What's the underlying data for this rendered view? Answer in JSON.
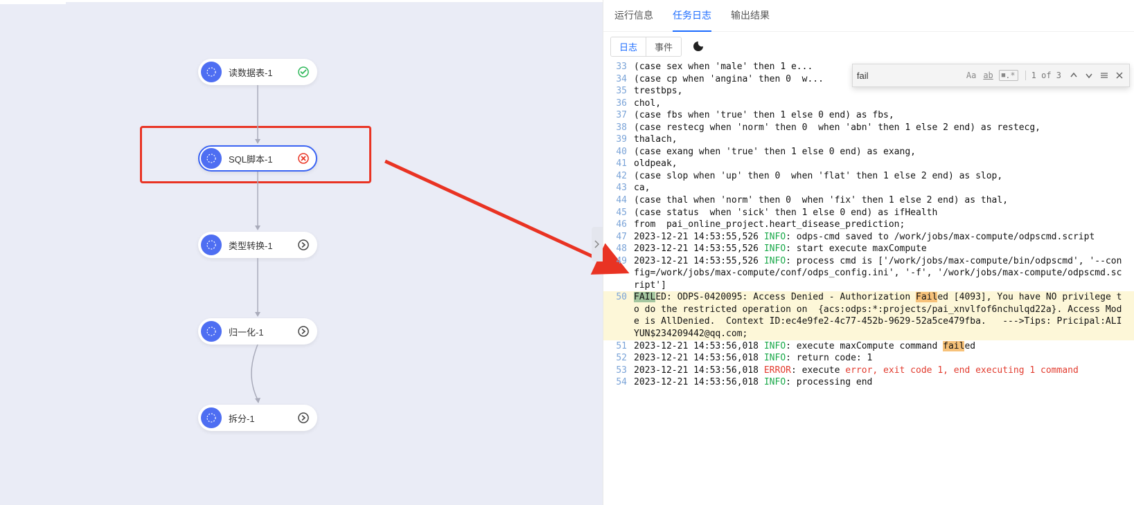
{
  "nodes": {
    "n1": {
      "label": "读数据表-1",
      "status": "success"
    },
    "n2": {
      "label": "SQL脚本-1",
      "status": "error",
      "selected": true
    },
    "n3": {
      "label": "类型转换-1",
      "status": "more"
    },
    "n4": {
      "label": "归一化-1",
      "status": "more"
    },
    "n5": {
      "label": "拆分-1",
      "status": "more"
    }
  },
  "tabs": {
    "runinfo": "运行信息",
    "tasklog": "任务日志",
    "output": "输出结果"
  },
  "subtabs": {
    "log": "日志",
    "event": "事件"
  },
  "search": {
    "value": "fail",
    "count": "1 of 3",
    "icons": {
      "case": "Aa",
      "word": "ab",
      "regex": ".*"
    }
  },
  "log": [
    {
      "n": "33",
      "t": "(case sex when 'male' then 1 e..."
    },
    {
      "n": "34",
      "t": "(case cp when 'angina' then 0  w..."
    },
    {
      "n": "35",
      "t": "trestbps,"
    },
    {
      "n": "36",
      "t": "chol,"
    },
    {
      "n": "37",
      "t": "(case fbs when 'true' then 1 else 0 end) as fbs,"
    },
    {
      "n": "38",
      "t": "(case restecg when 'norm' then 0  when 'abn' then 1 else 2 end) as restecg,"
    },
    {
      "n": "39",
      "t": "thalach,"
    },
    {
      "n": "40",
      "t": "(case exang when 'true' then 1 else 0 end) as exang,"
    },
    {
      "n": "41",
      "t": "oldpeak,"
    },
    {
      "n": "42",
      "t": "(case slop when 'up' then 0  when 'flat' then 1 else 2 end) as slop,"
    },
    {
      "n": "43",
      "t": "ca,"
    },
    {
      "n": "44",
      "t": "(case thal when 'norm' then 0  when 'fix' then 1 else 2 end) as thal,"
    },
    {
      "n": "45",
      "t": "(case status  when 'sick' then 1 else 0 end) as ifHealth"
    },
    {
      "n": "46",
      "t": "from  pai_online_project.heart_disease_prediction;"
    },
    {
      "n": "47",
      "t": "2023-12-21 14:53:55,526 <span class=\"kw-info\">INFO</span>: odps-cmd saved to /work/jobs/max-compute/odpscmd.script"
    },
    {
      "n": "48",
      "t": "2023-12-21 14:53:55,526 <span class=\"kw-info\">INFO</span>: start execute maxCompute"
    },
    {
      "n": "49",
      "t": "2023-12-21 14:53:55,526 <span class=\"kw-info\">INFO</span>: process cmd is ['/work/jobs/max-compute/bin/odpscmd', '--config=/work/jobs/max-compute/conf/odps_config.ini', '-f', '/work/jobs/max-compute/odpscmd.script']"
    },
    {
      "n": "50",
      "hl": true,
      "t": "<span class=\"kw-hlsel\">FAIL</span>ED: ODPS-0420095: Access Denied - Authorization <span class=\"kw-hl\">Fail</span>ed [4093], You have NO privilege to do the restricted operation on  {acs:odps:*:projects/pai_xnvlfof6nchulqd22a}. Access Mode is AllDenied.  Context ID:ec4e9fe2-4c77-452b-9629-52a5ce479fba.   --->Tips: Pricipal:ALIYUN$234209442@qq.com;"
    },
    {
      "n": "51",
      "t": "2023-12-21 14:53:56,018 <span class=\"kw-info\">INFO</span>: execute maxCompute command <span class=\"kw-hl\">fail</span>ed"
    },
    {
      "n": "52",
      "t": "2023-12-21 14:53:56,018 <span class=\"kw-info\">INFO</span>: return code: 1"
    },
    {
      "n": "53",
      "t": "2023-12-21 14:53:56,018 <span class=\"kw-error\">ERROR</span>: execute <span class=\"kw-red\">error, exit code 1, end executing 1 command</span>"
    },
    {
      "n": "54",
      "t": "2023-12-21 14:53:56,018 <span class=\"kw-info\">INFO</span>: processing end"
    }
  ]
}
